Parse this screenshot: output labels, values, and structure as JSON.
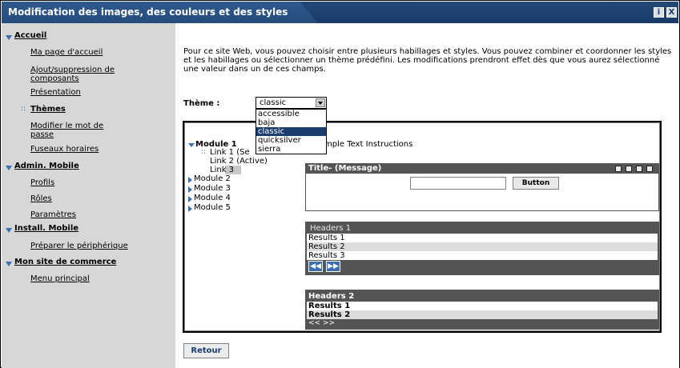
{
  "window": {
    "title": "Modification des images, des couleurs et des styles",
    "info_label": "i",
    "close_label": "X"
  },
  "sidebar": {
    "sections": [
      {
        "label": "Accueil",
        "items": [
          "Ma page d'accueil",
          "Ajout/suppression de",
          "composants",
          "Présentation",
          "Thèmes",
          "Modifier le mot de",
          "passe",
          "Fuseaux horaires"
        ]
      },
      {
        "label": "Admin. Mobile",
        "items": [
          "Profils",
          "Rôles",
          "Paramètres"
        ]
      },
      {
        "label": "Install. Mobile",
        "items": [
          "Préparer le périphérique"
        ]
      },
      {
        "label": "Mon site de commerce",
        "items": [
          "Menu principal"
        ]
      }
    ],
    "current_item": "Thèmes"
  },
  "main": {
    "description": "Pour ce site Web, vous pouvez choisir entre plusieurs habillages et styles. Vous pouvez combiner et coordonner les styles et les habillages ou sélectionner un thème prédéfini. Les modifications prendront effet dès que vous aurez sélectionné une valeur dans un de ces champs.",
    "theme_label": "Thème :",
    "theme_value": "classic",
    "theme_options": [
      "accessible",
      "baja",
      "classic",
      "quicksilver",
      "sierra"
    ],
    "retour_label": "Retour"
  },
  "preview": {
    "modules": [
      "Module 1",
      "Module 2",
      "Module 3",
      "Module 4",
      "Module 5"
    ],
    "links": [
      "Link 1 (Se",
      "Link 2 (Active)",
      "Link 3"
    ],
    "sample_text": "2 Sample Text Instructions",
    "portlet_title": "Title- (Message)",
    "button_label": "Button",
    "table1": {
      "header": "Headers 1",
      "rows": [
        "Results 1",
        "Results 2",
        "Results 3"
      ]
    },
    "table2": {
      "header": "Headers 2",
      "rows": [
        "Results 1",
        "Results 2"
      ],
      "pager": "<< >>"
    }
  }
}
